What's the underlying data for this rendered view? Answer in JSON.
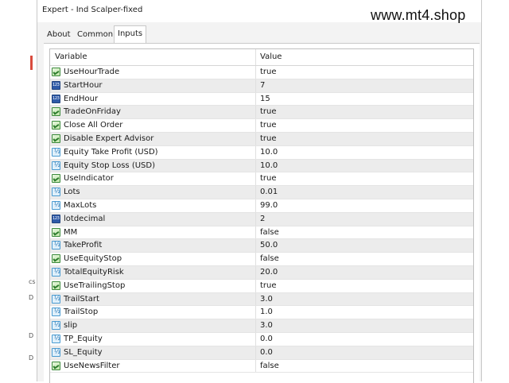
{
  "window": {
    "title": "Expert - Ind Scalper-fixed"
  },
  "watermark": "www.mt4.shop",
  "tabs": [
    {
      "label": "About"
    },
    {
      "label": "Common"
    },
    {
      "label": "Inputs",
      "active": true
    }
  ],
  "table": {
    "headers": {
      "variable": "Variable",
      "value": "Value"
    },
    "rows": [
      {
        "icon": "bool-icon",
        "name": "UseHourTrade",
        "value": "true"
      },
      {
        "icon": "int-icon",
        "name": "StartHour",
        "value": "7"
      },
      {
        "icon": "int-icon",
        "name": "EndHour",
        "value": "15"
      },
      {
        "icon": "bool-icon",
        "name": "TradeOnFriday",
        "value": "true"
      },
      {
        "icon": "bool-icon",
        "name": "Close All Order",
        "value": "true"
      },
      {
        "icon": "bool-icon",
        "name": "Disable Expert Advisor",
        "value": "true"
      },
      {
        "icon": "double-icon",
        "name": "Equity Take Profit (USD)",
        "value": "10.0"
      },
      {
        "icon": "double-icon",
        "name": "Equity Stop Loss (USD)",
        "value": "10.0"
      },
      {
        "icon": "bool-icon",
        "name": "UseIndicator",
        "value": "true"
      },
      {
        "icon": "double-icon",
        "name": "Lots",
        "value": "0.01"
      },
      {
        "icon": "double-icon",
        "name": "MaxLots",
        "value": "99.0"
      },
      {
        "icon": "int-icon",
        "name": "lotdecimal",
        "value": "2"
      },
      {
        "icon": "bool-icon",
        "name": "MM",
        "value": "false"
      },
      {
        "icon": "double-icon",
        "name": "TakeProfit",
        "value": "50.0"
      },
      {
        "icon": "bool-icon",
        "name": "UseEquityStop",
        "value": "false"
      },
      {
        "icon": "double-icon",
        "name": "TotalEquityRisk",
        "value": "20.0"
      },
      {
        "icon": "bool-icon",
        "name": "UseTrailingStop",
        "value": "true"
      },
      {
        "icon": "double-icon",
        "name": "TrailStart",
        "value": "3.0"
      },
      {
        "icon": "double-icon",
        "name": "TrailStop",
        "value": "1.0"
      },
      {
        "icon": "double-icon",
        "name": "slip",
        "value": "3.0"
      },
      {
        "icon": "double-icon",
        "name": "TP_Equity",
        "value": "0.0"
      },
      {
        "icon": "double-icon",
        "name": "SL_Equity",
        "value": "0.0"
      },
      {
        "icon": "bool-icon",
        "name": "UseNewsFilter",
        "value": "false"
      }
    ]
  },
  "background_marks": [
    "cs",
    "D",
    "D",
    "D"
  ]
}
